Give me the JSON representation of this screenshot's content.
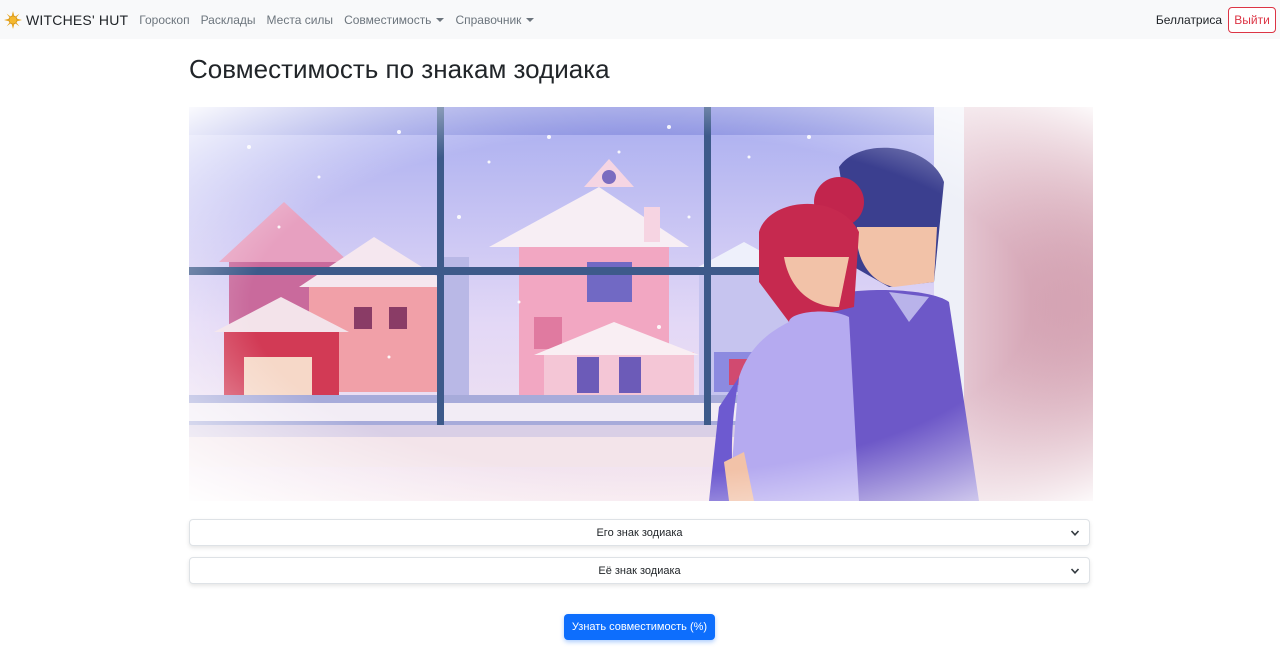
{
  "navbar": {
    "brand": "WITCHES' HUT",
    "brand_icon": "sun-logo-icon",
    "links": [
      {
        "label": "Гороскоп",
        "dropdown": false
      },
      {
        "label": "Расклады",
        "dropdown": false
      },
      {
        "label": "Места силы",
        "dropdown": false
      },
      {
        "label": "Совместимость",
        "dropdown": true
      },
      {
        "label": "Справочник",
        "dropdown": true
      }
    ],
    "user": "Беллатриса",
    "logout_label": "Выйти"
  },
  "main": {
    "title": "Совместимость по знакам зодиака",
    "his_sign_placeholder": "Его знак зодиака",
    "her_sign_placeholder": "Её знак зодиака",
    "submit_label": "Узнать совместимость (%)"
  },
  "colors": {
    "navbar_bg": "#f8f9fa",
    "primary": "#0d6efd",
    "danger": "#dc3545"
  }
}
